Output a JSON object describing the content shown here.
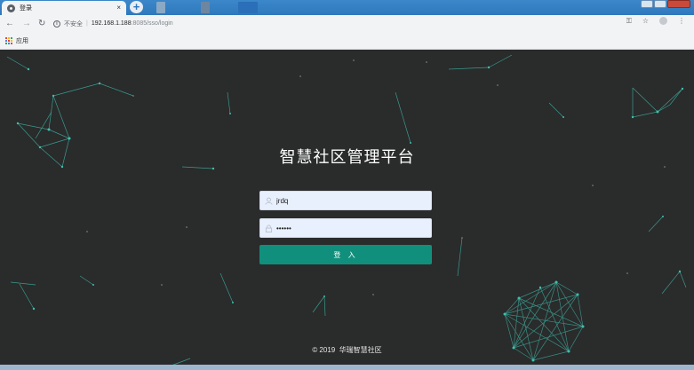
{
  "browser": {
    "tab_title": "登录",
    "tab_close": "×",
    "new_tab": "+",
    "url_security": "不安全",
    "url_separator": "|",
    "url_host": "192.168.1.188",
    "url_path": ":8085/sso/login",
    "bookmark_apps_label": "应用",
    "icons": [
      "back-icon",
      "forward-icon",
      "reload-icon",
      "info-icon",
      "key-icon",
      "star-icon",
      "profile-icon",
      "menu-icon",
      "apps-icon"
    ]
  },
  "login": {
    "title": "智慧社区管理平台",
    "username_value": "jrdq",
    "password_value": "••••••",
    "submit_label": "登 入"
  },
  "footer": {
    "copyright": "© 2019",
    "company": "华瑞智慧社区"
  },
  "colors": {
    "page_background": "#2a2b2b",
    "accent_teal": "#10907c",
    "network_line": "#3fbfae",
    "input_fill": "#e8f0fe"
  }
}
